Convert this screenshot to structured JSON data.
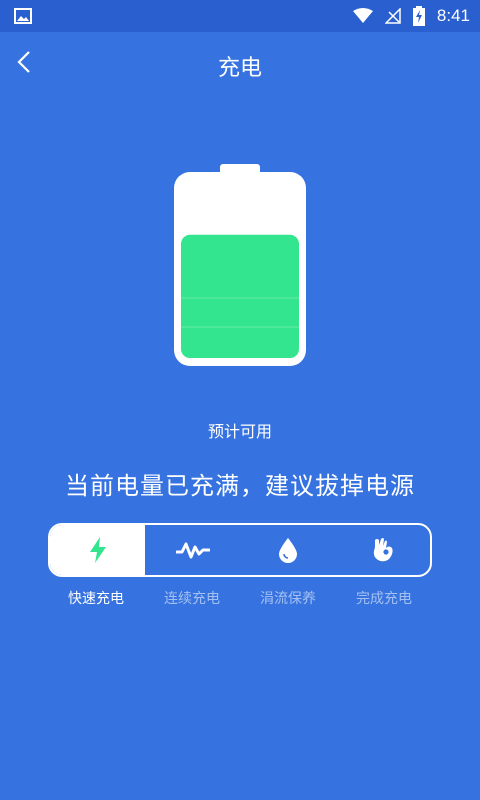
{
  "status_bar": {
    "time": "8:41"
  },
  "header": {
    "title": "充电"
  },
  "battery": {
    "level_fraction": 0.7,
    "fill_color": "#34e58f"
  },
  "estimate_label": "预计可用",
  "status_message": "当前电量已充满，建议拔掉电源",
  "tabs": [
    {
      "label": "快速充电",
      "icon": "lightning-icon",
      "active": true
    },
    {
      "label": "连续充电",
      "icon": "pulse-wave-icon",
      "active": false
    },
    {
      "label": "涓流保养",
      "icon": "water-drop-icon",
      "active": false
    },
    {
      "label": "完成充电",
      "icon": "ok-hand-icon",
      "active": false
    }
  ],
  "colors": {
    "background": "#3673e0",
    "accent": "#34e58f"
  }
}
